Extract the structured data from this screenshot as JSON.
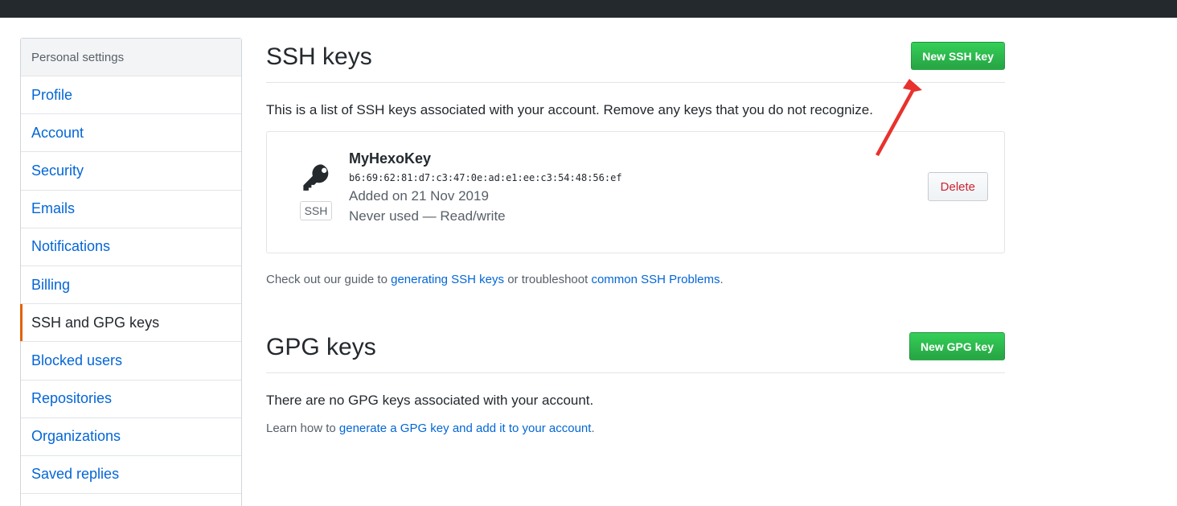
{
  "sidebar": {
    "header": "Personal settings",
    "items": [
      {
        "label": "Profile"
      },
      {
        "label": "Account"
      },
      {
        "label": "Security"
      },
      {
        "label": "Emails"
      },
      {
        "label": "Notifications"
      },
      {
        "label": "Billing"
      },
      {
        "label": "SSH and GPG keys",
        "selected": true
      },
      {
        "label": "Blocked users"
      },
      {
        "label": "Repositories"
      },
      {
        "label": "Organizations"
      },
      {
        "label": "Saved replies"
      }
    ]
  },
  "ssh": {
    "title": "SSH keys",
    "new_button": "New SSH key",
    "description": "This is a list of SSH keys associated with your account. Remove any keys that you do not recognize.",
    "key": {
      "icon": "key-icon",
      "badge": "SSH",
      "name": "MyHexoKey",
      "fingerprint": "b6:69:62:81:d7:c3:47:0e:ad:e1:ee:c3:54:48:56:ef",
      "added": "Added on 21 Nov 2019",
      "usage": "Never used — Read/write",
      "delete_button": "Delete"
    },
    "help": {
      "prefix": "Check out our guide to ",
      "link1": "generating SSH keys",
      "middle": " or troubleshoot ",
      "link2": "common SSH Problems",
      "suffix": "."
    }
  },
  "gpg": {
    "title": "GPG keys",
    "new_button": "New GPG key",
    "empty": "There are no GPG keys associated with your account.",
    "help": {
      "prefix": "Learn how to ",
      "link": "generate a GPG key and add it to your account",
      "suffix": "."
    }
  },
  "colors": {
    "topbar": "#24292e",
    "link": "#0366d6",
    "primary_button": "#28a745",
    "danger_text": "#cb2431",
    "selected_marker": "#e36209",
    "annotation_arrow": "#e8322d"
  }
}
